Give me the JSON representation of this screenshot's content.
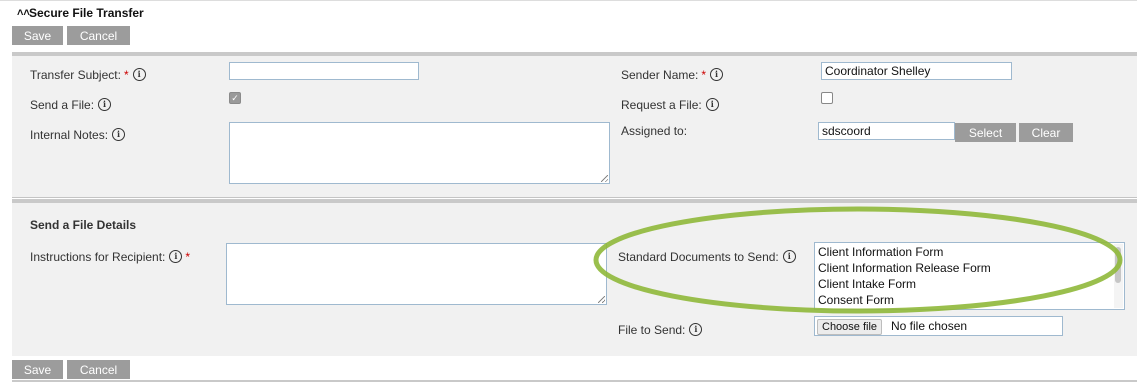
{
  "header": {
    "collapse_icon": "double-chevron-up-icon",
    "title": "Secure File Transfer",
    "save_label": "Save",
    "cancel_label": "Cancel"
  },
  "details": {
    "transfer_subject_label": "Transfer Subject:",
    "transfer_subject_value": "",
    "sender_name_label": "Sender Name:",
    "sender_name_value": "Coordinator Shelley",
    "send_file_label": "Send a File:",
    "send_file_checked": true,
    "request_file_label": "Request a File:",
    "request_file_checked": false,
    "internal_notes_label": "Internal Notes:",
    "internal_notes_value": "",
    "assigned_to_label": "Assigned to:",
    "assigned_to_value": "sdscoord",
    "select_label": "Select",
    "clear_label": "Clear",
    "required_mark": "*",
    "info_glyph": "i"
  },
  "send_file_details": {
    "heading": "Send a File Details",
    "instructions_label": "Instructions for Recipient:",
    "instructions_value": "",
    "standard_docs_label": "Standard Documents to Send:",
    "standard_docs": [
      "Client Information Form",
      "Client Information Release Form",
      "Client Intake Form",
      "Consent Form"
    ],
    "file_to_send_label": "File to Send:",
    "choose_file_label": "Choose file",
    "no_file_text": "No file chosen"
  },
  "footer": {
    "save_label": "Save",
    "cancel_label": "Cancel"
  },
  "colors": {
    "highlight_ellipse": "#8fb83a",
    "button_bg": "#9c9c9c",
    "required": "#cc0000"
  }
}
